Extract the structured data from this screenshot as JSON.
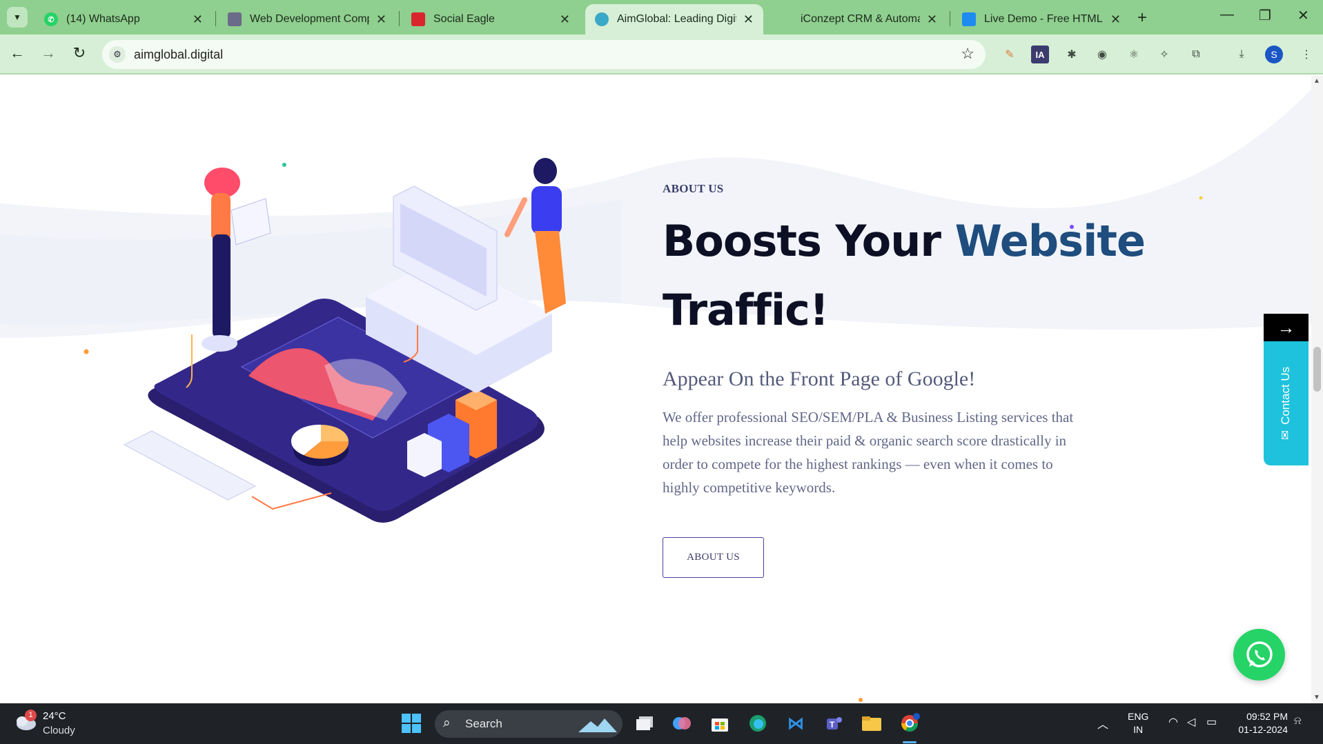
{
  "browser": {
    "tabs": [
      {
        "title": "(14) WhatsApp",
        "active": false
      },
      {
        "title": "Web Development Compa",
        "active": false
      },
      {
        "title": "Social Eagle",
        "active": false
      },
      {
        "title": "AimGlobal: Leading Digital",
        "active": true
      },
      {
        "title": "iConzept CRM & Automati",
        "active": false
      },
      {
        "title": "Live Demo - Free HTML Te",
        "active": false
      }
    ],
    "url": "aimglobal.digital",
    "profile_initial": "S"
  },
  "page": {
    "eyebrow": "ABOUT US",
    "headline_part1": "Boosts Your ",
    "headline_accent": "Website",
    "headline_part2": "Traffic!",
    "subheading": "Appear On the Front Page of Google!",
    "body": "We offer professional SEO/SEM/PLA & Business Listing services that help websites increase their paid & organic search score drastically in order to compete for the highest rankings — even when it comes to highly competitive keywords.",
    "cta_label": "ABOUT US",
    "side_arrow": "→",
    "contact_label": "Contact Us",
    "colors": {
      "accent": "#1e4d7e",
      "headline": "#0d1024",
      "contact_tab": "#1fc2dc",
      "whatsapp": "#25d366",
      "button_border": "#4b3b99"
    }
  },
  "taskbar": {
    "weather_badge": "1",
    "temperature": "24°C",
    "condition": "Cloudy",
    "search_label": "Search",
    "language_line1": "ENG",
    "language_line2": "IN",
    "time": "09:52 PM",
    "date": "01-12-2024"
  }
}
